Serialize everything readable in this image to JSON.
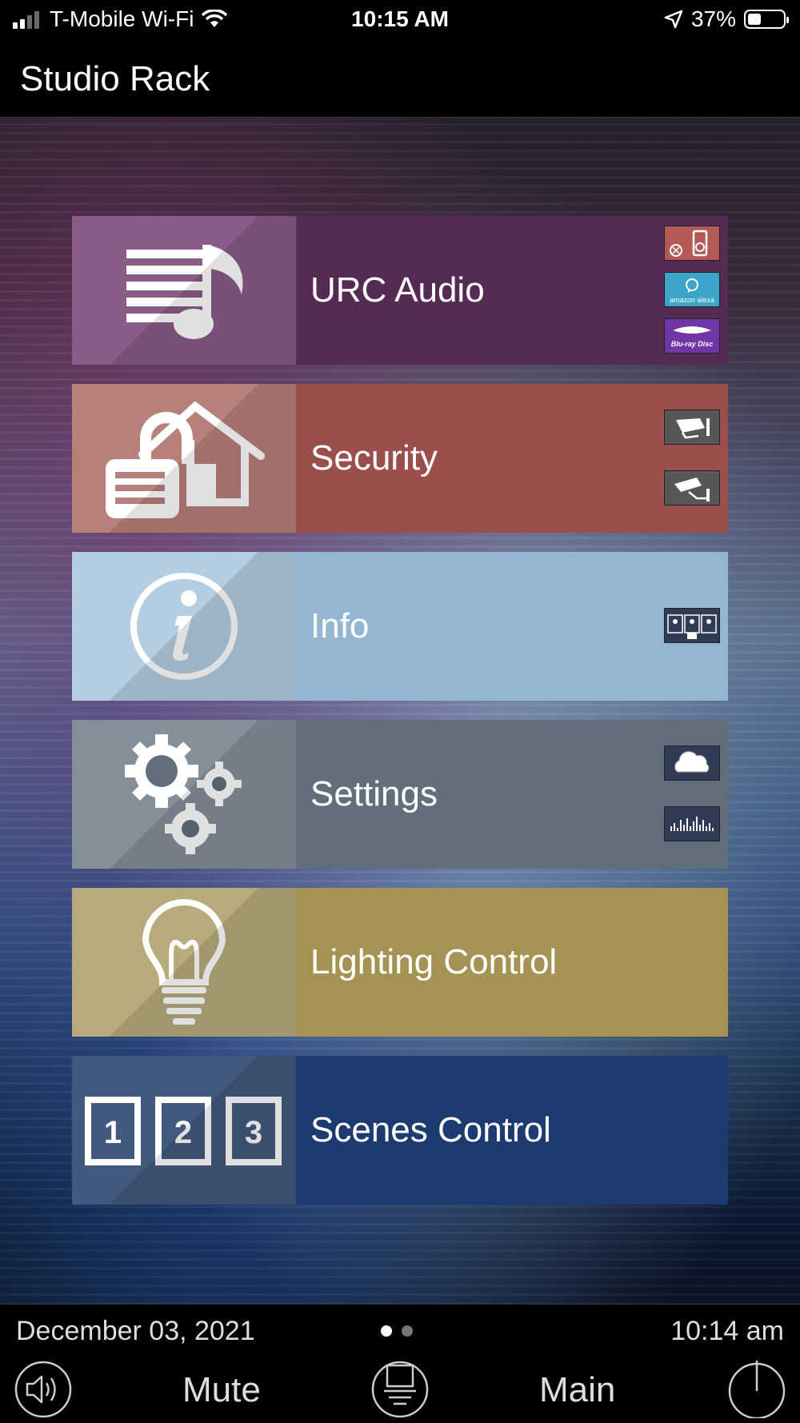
{
  "status_bar": {
    "carrier": "T-Mobile Wi-Fi",
    "time": "10:15 AM",
    "battery": "37%",
    "battery_level": 0.37
  },
  "header": {
    "title": "Studio Rack"
  },
  "tiles": [
    {
      "label": "URC Audio",
      "color": "#552b54",
      "icon_color": "#8a5c88",
      "icon": "music-playlist-icon",
      "sub_icons": [
        "ipod-icon",
        "amazon-alexa-icon",
        "bluray-disc-icon"
      ],
      "sub_icon_labels": {
        "alexa": "amazon alexa",
        "bluray": "Blu-ray Disc"
      }
    },
    {
      "label": "Security",
      "color": "#9b4e4c",
      "icon_color": "#b8807b",
      "icon": "lock-house-icon",
      "sub_icons": [
        "security-camera-icon",
        "security-camera-icon"
      ]
    },
    {
      "label": "Info",
      "color": "#94b6d3",
      "icon_color": "#b3cde2",
      "icon": "info-icon",
      "sub_icons": [
        "video-conference-icon"
      ]
    },
    {
      "label": "Settings",
      "color": "#626f7b",
      "icon_color": "#858f99",
      "icon": "gears-icon",
      "sub_icons": [
        "cloud-icon",
        "audio-waveform-icon"
      ]
    },
    {
      "label": "Lighting Control",
      "color": "#a49352",
      "icon_color": "#b8ab7b",
      "icon": "light-bulb-icon",
      "sub_icons": []
    },
    {
      "label": "Scenes Control",
      "color": "#1d3b70",
      "icon_color": "#44597f",
      "icon": "scenes-123-icon",
      "scene_numbers": [
        "1",
        "2",
        "3"
      ],
      "sub_icons": []
    }
  ],
  "footer": {
    "date": "December 03, 2021",
    "time": "10:14 am",
    "page_count": 2,
    "active_page": 1,
    "mute_label": "Mute",
    "main_label": "Main"
  }
}
